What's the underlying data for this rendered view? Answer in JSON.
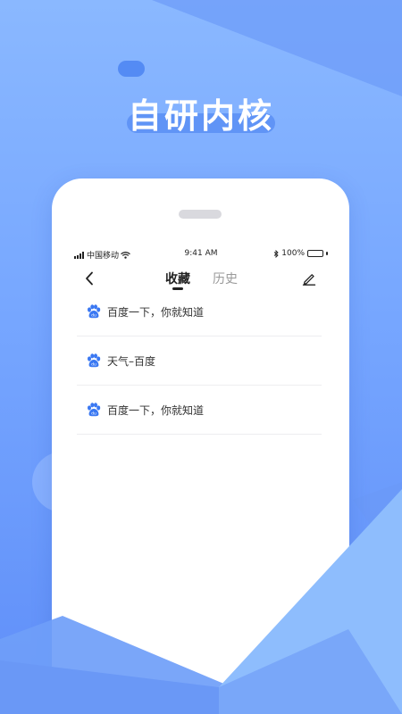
{
  "promo": {
    "headline": "自研内核"
  },
  "status_bar": {
    "carrier": "中国移动",
    "time": "9:41 AM",
    "battery": "100%"
  },
  "nav": {
    "tabs": [
      {
        "label": "收藏",
        "active": true
      },
      {
        "label": "历史",
        "active": false
      }
    ]
  },
  "bookmarks": [
    {
      "title": "百度一下，你就知道",
      "icon": "baidu-paw-icon"
    },
    {
      "title": "天气–百度",
      "icon": "baidu-paw-icon"
    },
    {
      "title": "百度一下，你就知道",
      "icon": "baidu-paw-icon"
    }
  ],
  "colors": {
    "background_top": "#8ab8ff",
    "background_bottom": "#5f8ef8",
    "accent_blue": "#3a78f2",
    "headline_text": "#ffffff"
  }
}
